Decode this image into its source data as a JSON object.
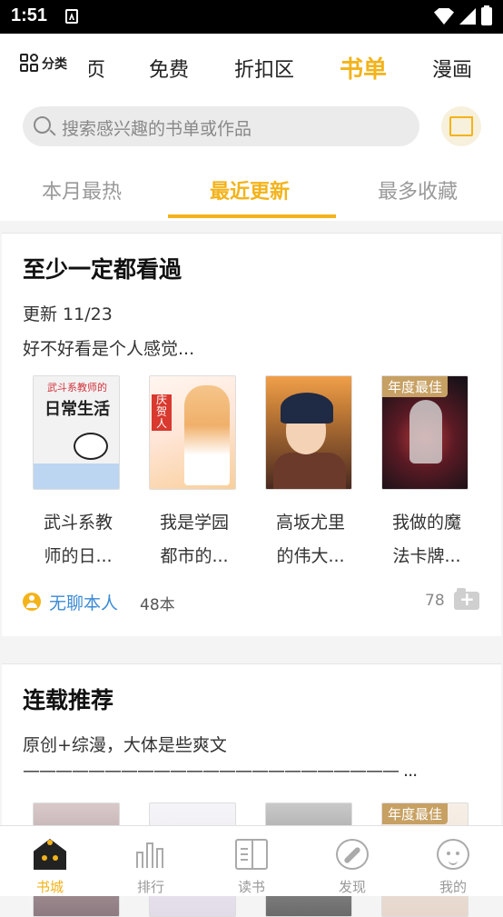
{
  "status_bar": {
    "time": "1:51"
  },
  "top_nav": {
    "category_label": "分类",
    "tabs": [
      {
        "label": "首页",
        "active": false
      },
      {
        "label": "免费",
        "active": false
      },
      {
        "label": "折扣区",
        "active": false
      },
      {
        "label": "书单",
        "active": true
      },
      {
        "label": "漫画",
        "active": false
      }
    ]
  },
  "search": {
    "placeholder": "搜索感兴趣的书单或作品"
  },
  "sub_tabs": [
    {
      "label": "本月最热",
      "active": false
    },
    {
      "label": "最近更新",
      "active": true
    },
    {
      "label": "最多收藏",
      "active": false
    }
  ],
  "booklists": [
    {
      "title": "至少一定都看過",
      "updated": "更新 11/23",
      "description": "好不好看是个人感觉...",
      "books": [
        {
          "title_line1": "武斗系教",
          "title_line2": "师的日...",
          "cover_text_top": "武斗系教师的",
          "cover_text_main": "日常生活"
        },
        {
          "title_line1": "我是学园",
          "title_line2": "都市的...",
          "cover_text_top": "庆贺人"
        },
        {
          "title_line1": "高坂尤里",
          "title_line2": "的伟大..."
        },
        {
          "title_line1": "我做的魔",
          "title_line2": "法卡牌...",
          "badge": "年度最佳"
        }
      ],
      "author": "无聊本人",
      "book_count": "48本",
      "favorites": "78"
    },
    {
      "title": "连载推荐",
      "description": "原创+综漫，大体是些爽文",
      "description_line2": "——————————————————————— ...",
      "books": [
        {},
        {},
        {},
        {
          "badge": "年度最佳"
        }
      ]
    }
  ],
  "bottom_nav": [
    {
      "label": "书城",
      "icon": "home-icon",
      "active": true
    },
    {
      "label": "排行",
      "icon": "bar-chart-icon",
      "active": false
    },
    {
      "label": "读书",
      "icon": "open-book-icon",
      "active": false
    },
    {
      "label": "发现",
      "icon": "compass-icon",
      "active": false
    },
    {
      "label": "我的",
      "icon": "cat-face-icon",
      "active": false
    }
  ],
  "colors": {
    "accent": "#f3b31a",
    "link": "#3b8ad6",
    "badge": "#c7a063"
  }
}
